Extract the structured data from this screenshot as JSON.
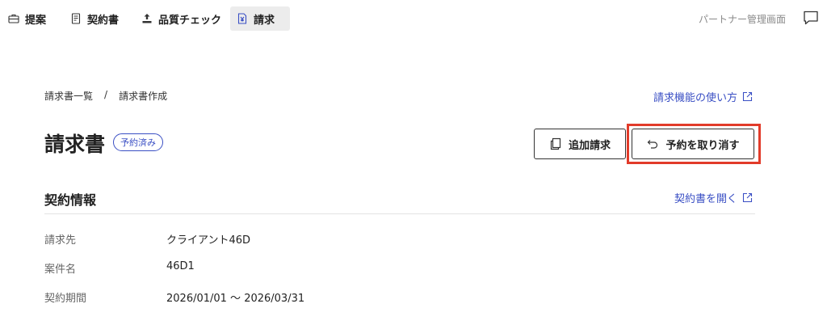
{
  "nav": {
    "items": [
      {
        "label": "提案",
        "icon": "briefcase-icon"
      },
      {
        "label": "契約書",
        "icon": "document-icon"
      },
      {
        "label": "品質チェック",
        "icon": "upload-icon"
      },
      {
        "label": "請求",
        "icon": "invoice-icon",
        "active": true
      }
    ],
    "partner_link": "パートナー管理画面",
    "chat_icon": "chat-bubble-icon"
  },
  "breadcrumb": {
    "items": [
      "請求書一覧",
      "請求書作成"
    ],
    "separator": "/"
  },
  "help_link": "請求機能の使い方",
  "header": {
    "title": "請求書",
    "status_badge": "予約済み"
  },
  "actions": {
    "add_invoice": "追加請求",
    "cancel_reservation": "予約を取り消す"
  },
  "contract_section": {
    "title": "契約情報",
    "open_link": "契約書を開く",
    "rows": [
      {
        "label": "請求先",
        "value": "クライアント46D"
      },
      {
        "label": "案件名",
        "value": "46D1"
      },
      {
        "label": "契約期間",
        "value": "2026/01/01 〜 2026/03/31"
      }
    ]
  },
  "colors": {
    "accent": "#3a4fc4",
    "highlight": "#e23b2a",
    "active_tab_bg": "#ececec"
  }
}
